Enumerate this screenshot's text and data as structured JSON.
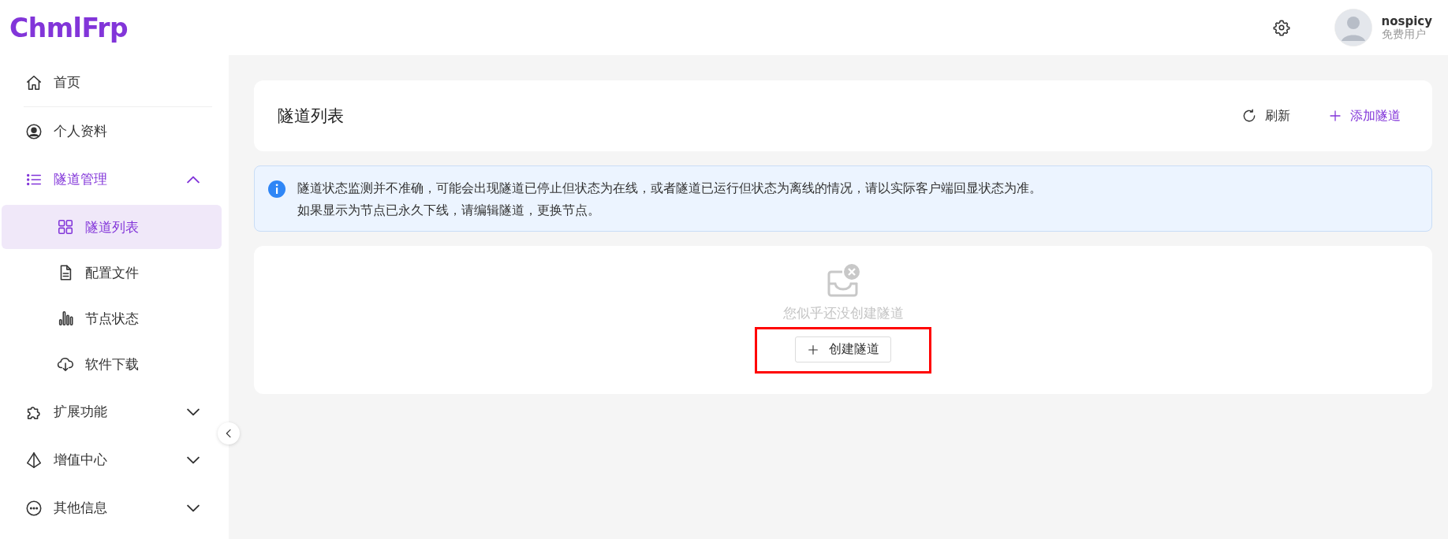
{
  "app": {
    "logo": "ChmlFrp"
  },
  "user": {
    "name": "nospicy",
    "tier": "免费用户"
  },
  "sidebar": {
    "items": [
      {
        "label": "首页",
        "selected": false
      },
      {
        "label": "个人资料",
        "selected": false
      },
      {
        "label": "隧道管理",
        "selected": false,
        "expanded": true,
        "children": [
          {
            "label": "隧道列表",
            "selected": true
          },
          {
            "label": "配置文件",
            "selected": false
          },
          {
            "label": "节点状态",
            "selected": false
          },
          {
            "label": "软件下载",
            "selected": false
          }
        ]
      },
      {
        "label": "扩展功能",
        "selected": false,
        "expanded": false
      },
      {
        "label": "增值中心",
        "selected": false,
        "expanded": false
      },
      {
        "label": "其他信息",
        "selected": false,
        "expanded": false
      }
    ]
  },
  "page": {
    "title": "隧道列表",
    "actions": [
      {
        "kind": "refresh",
        "label": "刷新"
      },
      {
        "kind": "add",
        "label": "添加隧道"
      }
    ]
  },
  "notice": {
    "lines": [
      "隧道状态监测并不准确，可能会出现隧道已停止但状态为在线，或者隧道已运行但状态为离线的情况，请以实际客户端回显状态为准。",
      "如果显示为节点已永久下线，请编辑隧道，更换节点。"
    ]
  },
  "empty_state": {
    "message": "您似乎还没创建隧道",
    "button": {
      "label": "创建隧道",
      "highlighted": true
    }
  }
}
